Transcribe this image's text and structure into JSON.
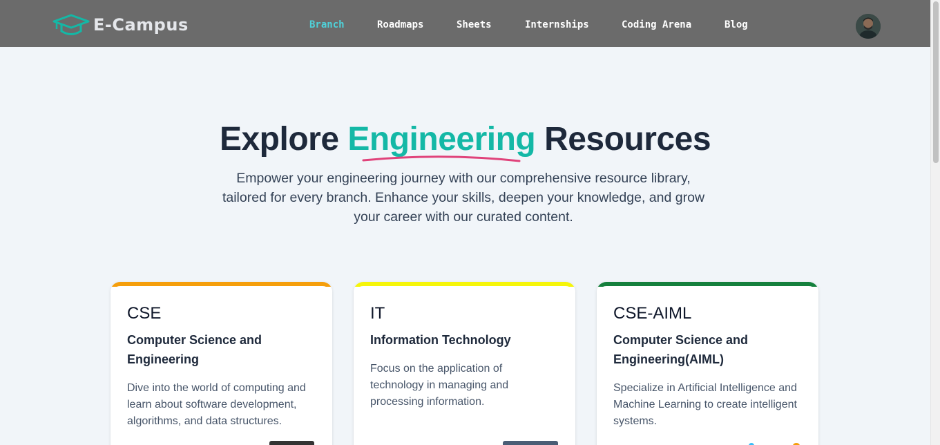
{
  "brand": {
    "name": "E-Campus"
  },
  "nav": {
    "items": [
      {
        "label": "Branch",
        "active": true
      },
      {
        "label": "Roadmaps",
        "active": false
      },
      {
        "label": "Sheets",
        "active": false
      },
      {
        "label": "Internships",
        "active": false
      },
      {
        "label": "Coding Arena",
        "active": false
      },
      {
        "label": "Blog",
        "active": false
      }
    ]
  },
  "hero": {
    "title_before": "Explore ",
    "title_accent": "Engineering",
    "title_after": " Resources",
    "subtitle": "Empower your engineering journey with our comprehensive resource library, tailored for every branch. Enhance your skills, deepen your knowledge, and grow your career with our curated content."
  },
  "cards": [
    {
      "code": "CSE",
      "name": "Computer Science and Engineering",
      "description": "Dive into the world of computing and learn about software development, algorithms, and data structures.",
      "accent_color": "#f59e0b"
    },
    {
      "code": "IT",
      "name": "Information Technology",
      "description": "Focus on the application of technology in managing and processing information.",
      "accent_color": "#f5f50a"
    },
    {
      "code": "CSE-AIML",
      "name": "Computer Science and Engineering(AIML)",
      "description": "Specialize in Artificial Intelligence and Machine Learning to create intelligent systems.",
      "accent_color": "#15803d"
    }
  ],
  "colors": {
    "navbar": "#6b6b6b",
    "active_link": "#4fd1d9",
    "accent": "#14b8a6",
    "underline": "#e0427a",
    "page_bg": "#f1f5f9"
  }
}
